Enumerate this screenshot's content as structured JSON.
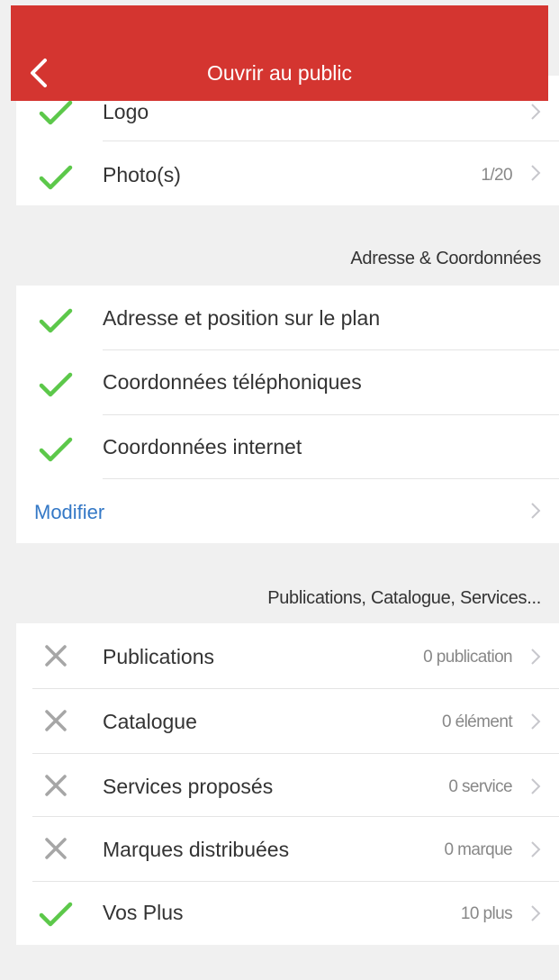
{
  "header": {
    "title": "Ouvrir au public"
  },
  "media": {
    "items": [
      {
        "label": "Logo",
        "value": "",
        "status": "check"
      },
      {
        "label": "Photo(s)",
        "value": "1/20",
        "status": "check"
      }
    ]
  },
  "address": {
    "section_title": "Adresse & Coordonnées",
    "items": [
      {
        "label": "Adresse et position sur le plan",
        "status": "check"
      },
      {
        "label": "Coordonnées téléphoniques",
        "status": "check"
      },
      {
        "label": "Coordonnées internet",
        "status": "check"
      }
    ],
    "modify_label": "Modifier"
  },
  "publications": {
    "section_title": "Publications, Catalogue, Services...",
    "items": [
      {
        "label": "Publications",
        "value": "0 publication",
        "status": "cross"
      },
      {
        "label": "Catalogue",
        "value": "0 élément",
        "status": "cross"
      },
      {
        "label": "Services proposés",
        "value": "0 service",
        "status": "cross"
      },
      {
        "label": "Marques distribuées",
        "value": "0 marque",
        "status": "cross"
      },
      {
        "label": "Vos Plus",
        "value": "10 plus",
        "status": "check"
      }
    ]
  },
  "colors": {
    "header": "#d43530",
    "check": "#5cc84a",
    "cross": "#a6a6a6",
    "link": "#3478c6"
  },
  "icons": {
    "back": "chevron-left-icon",
    "check": "checkmark-icon",
    "cross": "cross-icon",
    "row_arrow": "chevron-right-icon"
  }
}
